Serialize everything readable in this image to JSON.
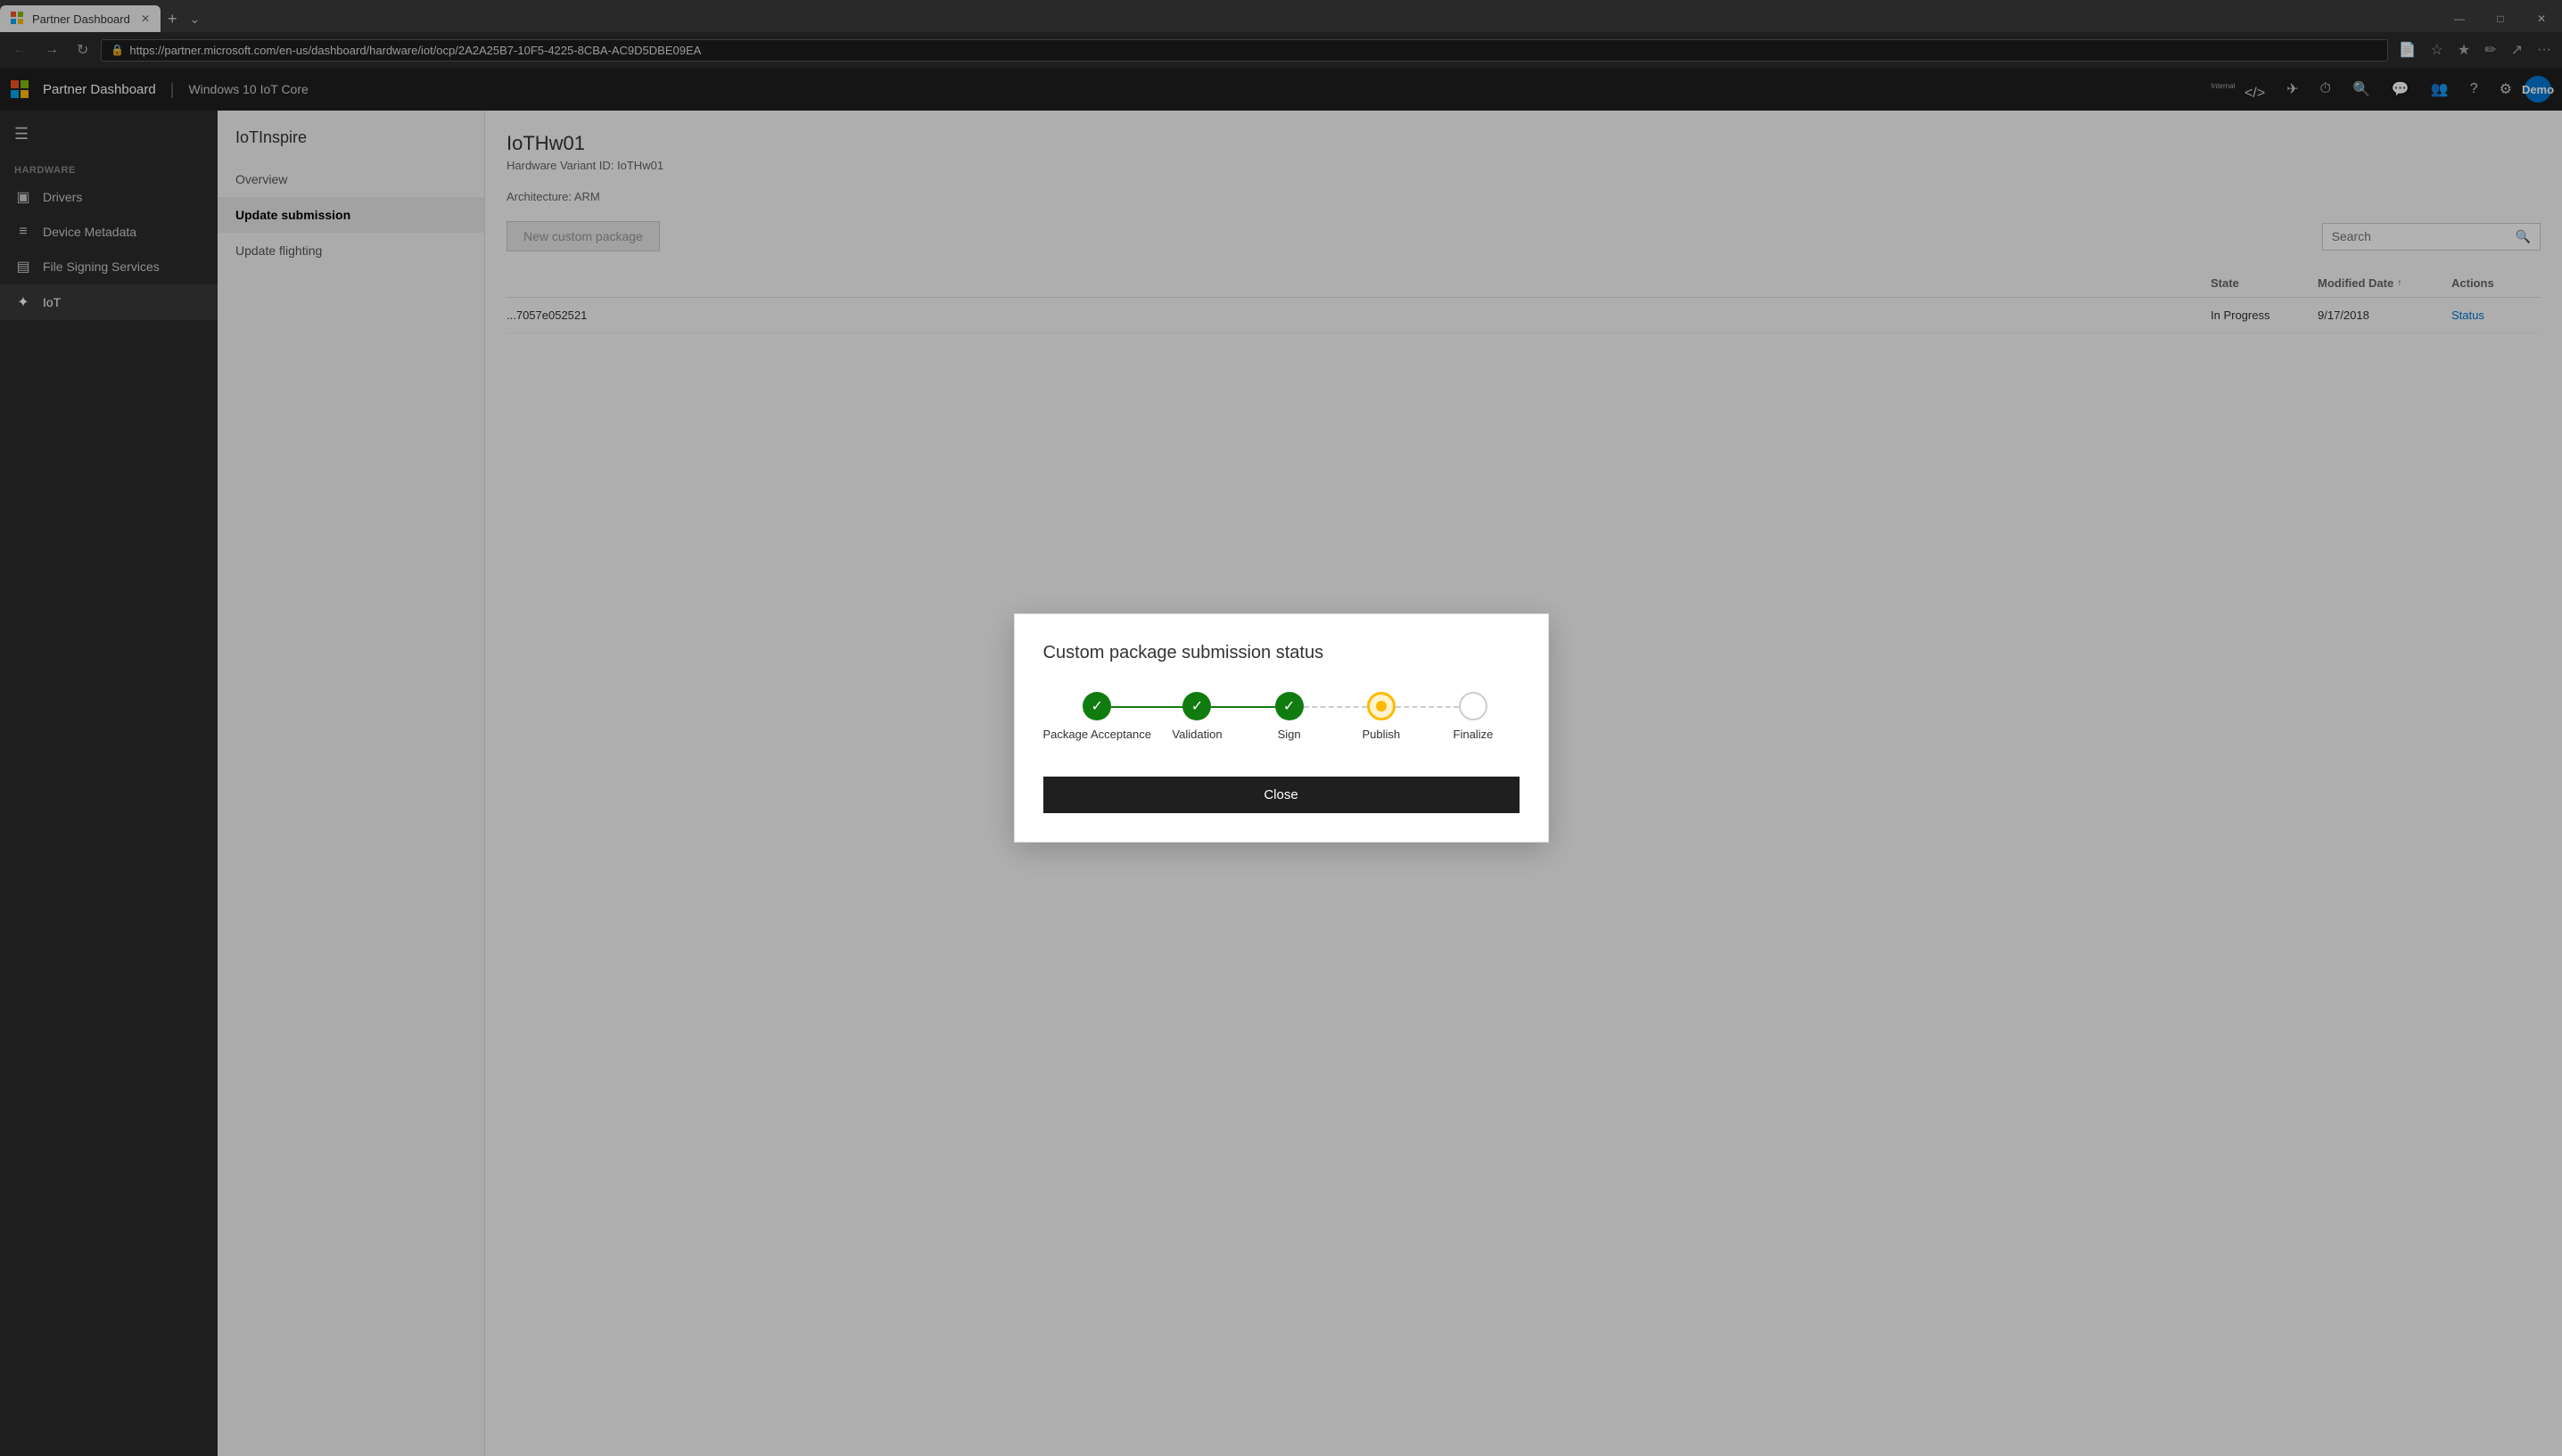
{
  "browser": {
    "tab_label": "Partner Dashboard",
    "url": "https://partner.microsoft.com/en-us/dashboard/hardware/iot/ocp/2A2A25B7-10F5-4225-8CBA-AC9D5DBE09EA",
    "new_tab_label": "+",
    "nav": {
      "back": "←",
      "forward": "→",
      "refresh": "↻"
    },
    "window_controls": {
      "minimize": "—",
      "maximize": "□",
      "close": "✕"
    }
  },
  "app_header": {
    "title": "Partner Dashboard",
    "divider": "|",
    "subtitle": "Windows 10 IoT Core",
    "internal_label": "Internal",
    "icons": {
      "code": "</>",
      "plane": "✈",
      "clock": "⏱",
      "search": "🔍",
      "chat": "💬",
      "people": "👥",
      "help": "?",
      "settings": "⚙"
    },
    "user": "Demo"
  },
  "sidebar": {
    "hardware_section": "HARDWARE",
    "items": [
      {
        "label": "Drivers",
        "icon": "▣"
      },
      {
        "label": "Device Metadata",
        "icon": "≡"
      },
      {
        "label": "File Signing Services",
        "icon": "▤"
      },
      {
        "label": "IoT",
        "icon": "✦"
      }
    ]
  },
  "secondary_nav": {
    "title": "IoTInspire",
    "items": [
      {
        "label": "Overview"
      },
      {
        "label": "Update submission"
      },
      {
        "label": "Update flighting"
      }
    ]
  },
  "main_content": {
    "page_title": "IoTHw01",
    "meta_line1": "Hardware Variant ID: IoTHw01",
    "meta_line2": "Architecture: ARM",
    "new_package_btn": "New custom package",
    "search_placeholder": "Search",
    "table": {
      "columns": [
        "State",
        "Modified Date",
        "Actions"
      ],
      "sort_col": "Modified Date",
      "rows": [
        {
          "id": "7057e052521",
          "state": "In Progress",
          "modified": "9/17/2018",
          "action": "Status"
        }
      ]
    }
  },
  "dialog": {
    "title": "Custom package submission status",
    "steps": [
      {
        "label": "Package Acceptance",
        "state": "complete"
      },
      {
        "label": "Validation",
        "state": "complete"
      },
      {
        "label": "Sign",
        "state": "complete"
      },
      {
        "label": "Publish",
        "state": "in-progress"
      },
      {
        "label": "Finalize",
        "state": "pending"
      }
    ],
    "close_btn": "Close"
  },
  "icons": {
    "check": "✓",
    "spinner": "●",
    "circle": "○",
    "sort_asc": "↑"
  }
}
